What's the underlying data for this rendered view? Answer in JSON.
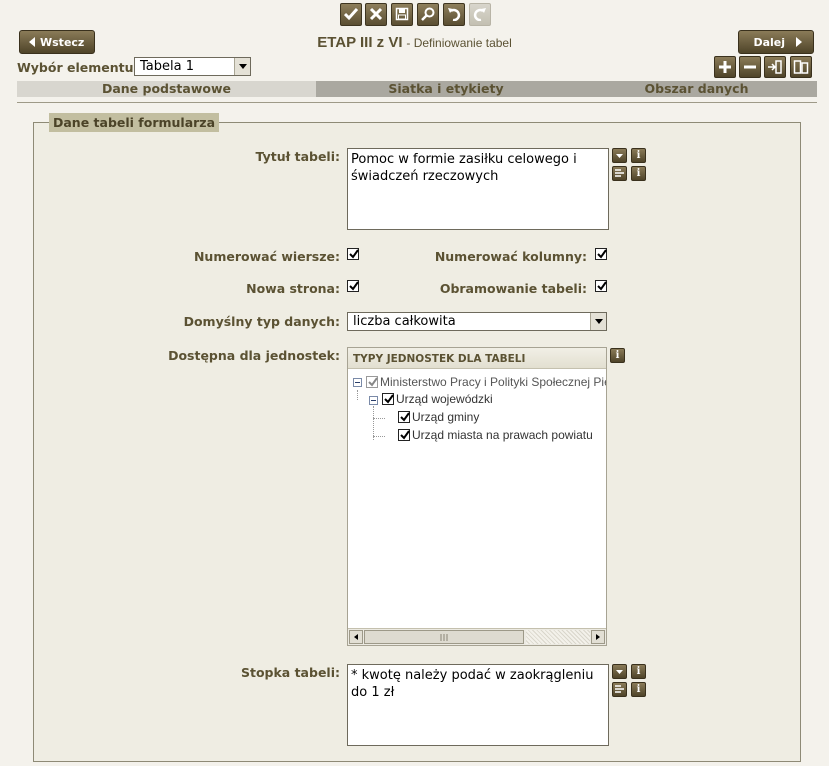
{
  "toolbar": {
    "icons": [
      "check-icon",
      "close-icon",
      "save-icon",
      "search-icon",
      "undo-icon",
      "redo-icon"
    ]
  },
  "nav": {
    "back_label": "Wstecz",
    "next_label": "Dalej"
  },
  "header": {
    "title": "ETAP III z VI",
    "subtitle": "- Definiowanie tabel"
  },
  "element_select": {
    "label": "Wybór elementu:",
    "value": "Tabela 1"
  },
  "tabs": [
    {
      "label": "Dane podstawowe",
      "active": true
    },
    {
      "label": "Siatka i etykiety",
      "active": false
    },
    {
      "label": "Obszar danych",
      "active": false
    }
  ],
  "form": {
    "legend": "Dane tabeli formularza",
    "title_label": "Tytuł tabeli:",
    "title_value_line1": "Pomoc w formie zasiłku celowego i",
    "title_value_line2": "świadczeń rzeczowych",
    "number_rows_label": "Numerować wiersze:",
    "number_rows_checked": true,
    "number_cols_label": "Numerować kolumny:",
    "number_cols_checked": true,
    "new_page_label": "Nowa strona:",
    "new_page_checked": true,
    "border_label": "Obramowanie tabeli:",
    "border_checked": true,
    "default_type_label": "Domyślny typ danych:",
    "default_type_value": "liczba całkowita",
    "available_label": "Dostępna dla jednostek:",
    "tree_header": "TYPY JEDNOSTEK DLA TABELI",
    "tree_nodes": [
      {
        "label": "Ministerstwo Pracy i Polityki Społecznej Pie"
      },
      {
        "label": "Urząd wojewódzki"
      },
      {
        "label": "Urząd gminy"
      },
      {
        "label": "Urząd miasta na prawach powiatu"
      }
    ],
    "footer_label": "Stopka tabeli:",
    "footer_value_line1": "* kwotę należy podać w zaokrągleniu",
    "footer_value_line2": "do 1 zł",
    "info_icon_text": "i"
  },
  "colors": {
    "button_dark": "#5a4e32",
    "label_text": "#5b5233",
    "legend_bg": "#c2bea0",
    "tab_bg": "#c8c6bf",
    "tab_active_bg": "#d8d6cf"
  }
}
